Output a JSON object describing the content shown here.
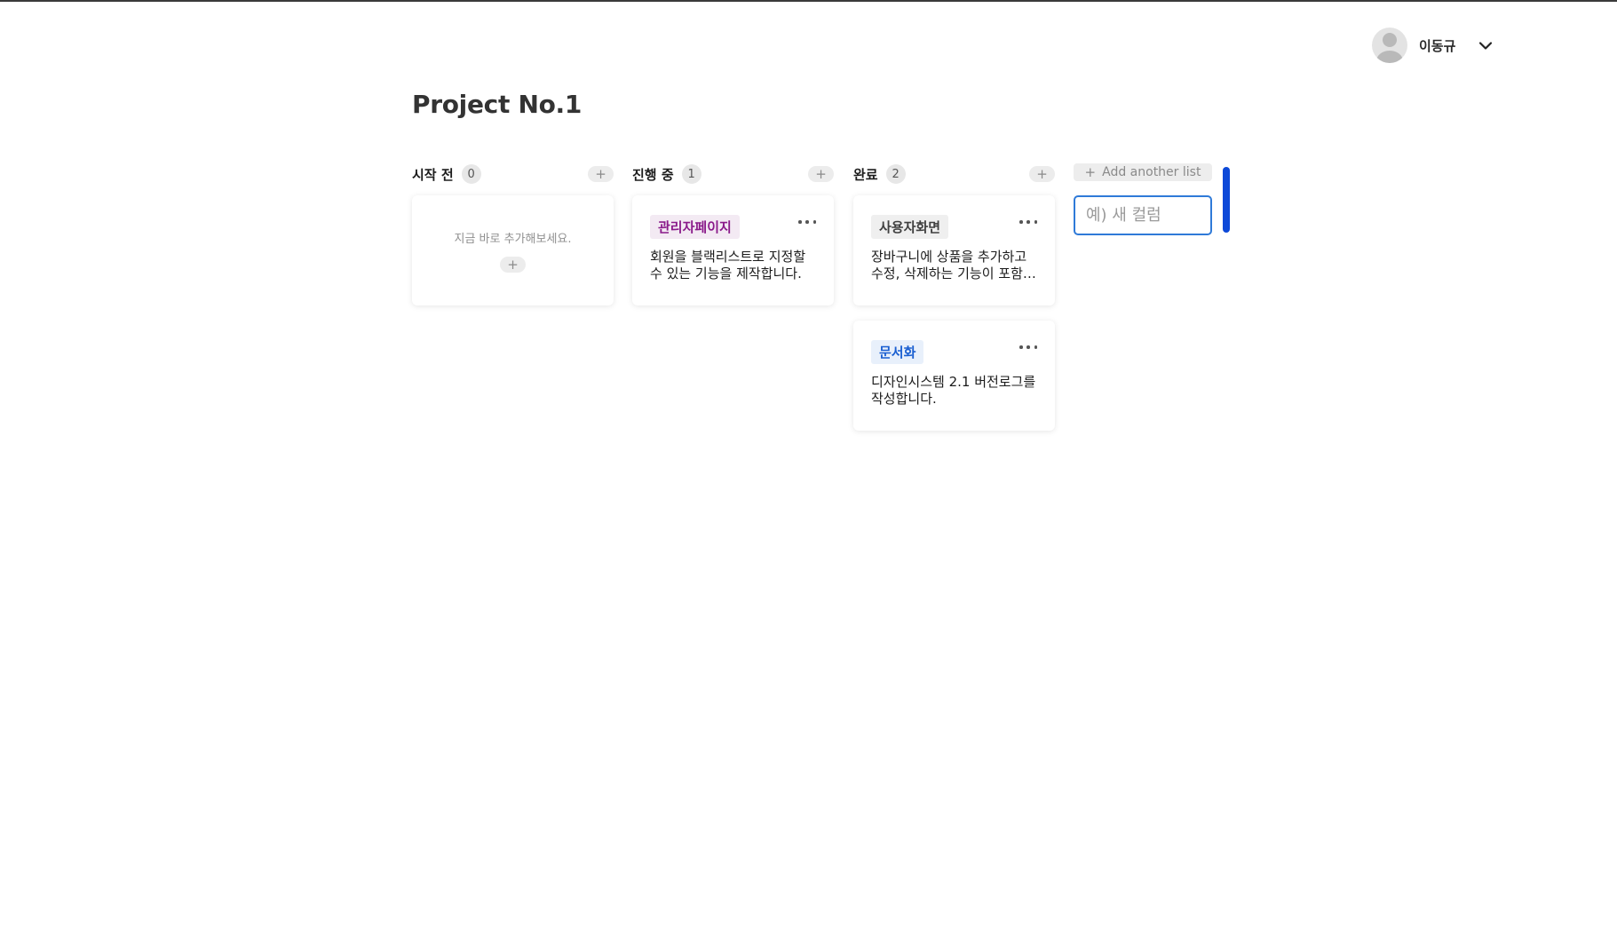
{
  "user": {
    "name": "이동규"
  },
  "project": {
    "title": "Project No.1"
  },
  "columns": [
    {
      "title": "시작 전",
      "count": "0",
      "add_label": "+",
      "empty_text": "지금 바로 추가해보세요.",
      "empty_add_label": "+",
      "cards": []
    },
    {
      "title": "진행 중",
      "count": "1",
      "add_label": "+",
      "cards": [
        {
          "tag": "관리자페이지",
          "tag_color": "#8a1a8a",
          "text": "회원을 블랙리스트로 지정할 수 있는 기능을 제작합니다."
        }
      ]
    },
    {
      "title": "완료",
      "count": "2",
      "add_label": "+",
      "cards": [
        {
          "tag": "사용자화면",
          "tag_color": "#3f3f3f",
          "text": "장바구니에 상품을 추가하고 수정, 삭제하는 기능이 포함됩니다."
        },
        {
          "tag": "문서화",
          "tag_color": "#1a5fd1",
          "text": "디자인시스템 2.1 버전로그를 작성합니다."
        }
      ]
    }
  ],
  "add_list": {
    "plus": "+",
    "label": "Add another list"
  },
  "new_column_input": {
    "placeholder": "예) 새 컬럼",
    "value": ""
  },
  "colors": {
    "accent": "#2f7ad8",
    "scrollbar": "#0d49d8"
  }
}
